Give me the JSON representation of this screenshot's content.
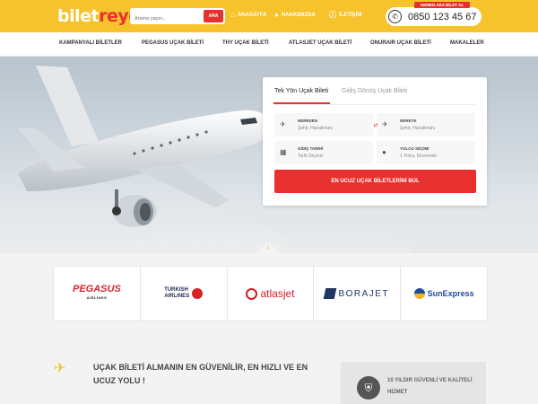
{
  "header": {
    "logo_part1": "bilet",
    "logo_part2": "reyon",
    "search_placeholder": "Arama yapın...",
    "search_button": "ARA",
    "nav": [
      {
        "label": "ANASAYFA",
        "icon": "home-icon"
      },
      {
        "label": "HAKKIMIZDA",
        "icon": "users-icon"
      },
      {
        "label": "İLETİŞİM",
        "icon": "info-icon"
      }
    ],
    "phone_tag": "HEMEN ARA BİLET AL",
    "phone_number": "0850 123 45 67"
  },
  "menu": [
    "KAMPANYALI BİLETLER",
    "PEGASUS UÇAK BİLETİ",
    "THY UÇAK BİLETİ",
    "ATLASJET UÇAK BİLETİ",
    "ONURAIR UÇAK BİLETİ",
    "MAKALELER"
  ],
  "booking": {
    "tabs": [
      "Tek Yön Uçak Bileti",
      "Gidiş Dönüş Uçak Bileti"
    ],
    "from_label": "NEREDEN",
    "from_value": "Şehir, Havalimanı",
    "to_label": "NEREYE",
    "to_value": "Şehir, Havalimanı",
    "date_label": "GİDİŞ TARİHİ",
    "date_value": "Tarih Seçiniz",
    "pax_label": "YOLCU SEÇİMİ",
    "pax_value": "1 Yolcu, Ekonomik",
    "submit": "EN UCUZ UÇAK BİLETLERİNİ BUL"
  },
  "airlines": {
    "pegasus": "PEGASUS",
    "pegasus_sub": "AIRLINES",
    "turkish_1": "TURKISH",
    "turkish_2": "AIRLINES",
    "atlasjet": "atlasjet",
    "borajet": "BORAJET",
    "sunexpress": "SunExpress"
  },
  "bottom": {
    "title": "UÇAK BİLETİ ALMANIN EN GÜVENİLİR, EN HIZLI VE EN UCUZ YOLU !",
    "card_text": "10 YILDIR GÜVENLİ VE KALİTELİ HİZMET"
  },
  "colors": {
    "brand_yellow": "#f6c32d",
    "brand_red": "#e8312e"
  }
}
